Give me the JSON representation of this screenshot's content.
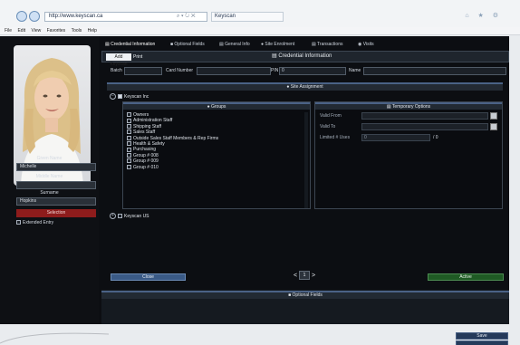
{
  "browser": {
    "url": "http://www.keyscan.ca",
    "address_tools": "⌕ ▾ ↻ ✕",
    "tab_title": "Keyscan",
    "window_icons": "⌂ ★ ⚙"
  },
  "menu": [
    "File",
    "Edit",
    "View",
    "Favorites",
    "Tools",
    "Help"
  ],
  "tabs": [
    {
      "label": "Credential Information",
      "icon": "card-icon",
      "active": true
    },
    {
      "label": "Optional Fields",
      "icon": "list-icon"
    },
    {
      "label": "General Info",
      "icon": "info-icon"
    },
    {
      "label": "Site Enrolment",
      "icon": "user-icon"
    },
    {
      "label": "Transactions",
      "icon": "document-icon"
    },
    {
      "label": "Visits",
      "icon": "visits-icon"
    }
  ],
  "credential": {
    "add_label": "Add Keyscan",
    "print_label": "Print",
    "title": "Credential Information",
    "batch_label": "Batch",
    "batch_value": "",
    "card_label": "Card Number",
    "card_value": "",
    "pin_label": "PIN",
    "pin_value": "0",
    "name_label": "Name",
    "name_value": ""
  },
  "sidebar": {
    "given_label": "Given Name",
    "given_value": "Michelle",
    "middle_label": "Middle Name",
    "middle_value": "",
    "surname_label": "Surname",
    "surname_value": "Hopkins",
    "select_label": "Selection",
    "extended_label": "Extended Entry"
  },
  "site": {
    "title": "Site Assignment",
    "site1": "Keyscan Inc",
    "site2": "Keyscan US",
    "groups_title": "Groups",
    "groups": [
      "Owners",
      "Administration Staff",
      "Shipping Staff",
      "Sales Staff",
      "Outside Sales Staff Members & Rep Firms",
      "Health & Safety",
      "Purchasing",
      "Group # 008",
      "Group # 009",
      "Group # 010"
    ],
    "temp_title": "Temporary Options",
    "valid_from": "Valid From",
    "valid_to": "Valid To",
    "limited_uses": "Limited # Uses",
    "uses_value": "0",
    "uses_max": "/ 0"
  },
  "footer": {
    "close_label": "Close",
    "prev": "<",
    "page": "1",
    "next": ">",
    "active_label": "Active",
    "optional_title": "Optional Fields",
    "save_label": "Save"
  },
  "colors": {
    "accent": "#4a6286",
    "danger": "#8e1c1c",
    "success": "#1f5a24",
    "app_bg": "#0c0e12"
  }
}
